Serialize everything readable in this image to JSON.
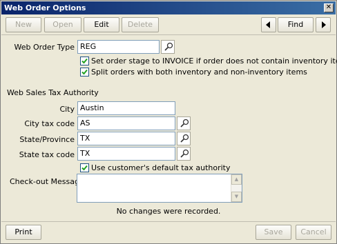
{
  "window": {
    "title": "Web Order Options"
  },
  "toolbar": {
    "new_label": "New",
    "open_label": "Open",
    "edit_label": "Edit",
    "delete_label": "Delete",
    "find_label": "Find"
  },
  "web_order_type": {
    "label": "Web Order Type",
    "value": "REG"
  },
  "options": {
    "set_stage": {
      "label": "Set order stage to INVOICE if order does not contain inventory items",
      "checked": true
    },
    "split_orders": {
      "label": "Split orders with both inventory and non-inventory items",
      "checked": true
    }
  },
  "tax": {
    "section_label": "Web Sales Tax Authority",
    "city_label": "City",
    "city_value": "Austin",
    "city_code_label": "City tax code",
    "city_code_value": "AS",
    "state_label": "State/Province",
    "state_value": "TX",
    "state_code_label": "State tax code",
    "state_code_value": "TX",
    "default_auth_label": "Use customer's default tax authority",
    "default_auth_checked": true
  },
  "checkout": {
    "label": "Check-out Message",
    "value": ""
  },
  "status": "No changes were recorded.",
  "bottom": {
    "print_label": "Print",
    "save_label": "Save",
    "cancel_label": "Cancel"
  },
  "colors": {
    "title_start": "#0a246a",
    "title_end": "#3a6ea5",
    "disabled_text": "#a8a69c"
  }
}
